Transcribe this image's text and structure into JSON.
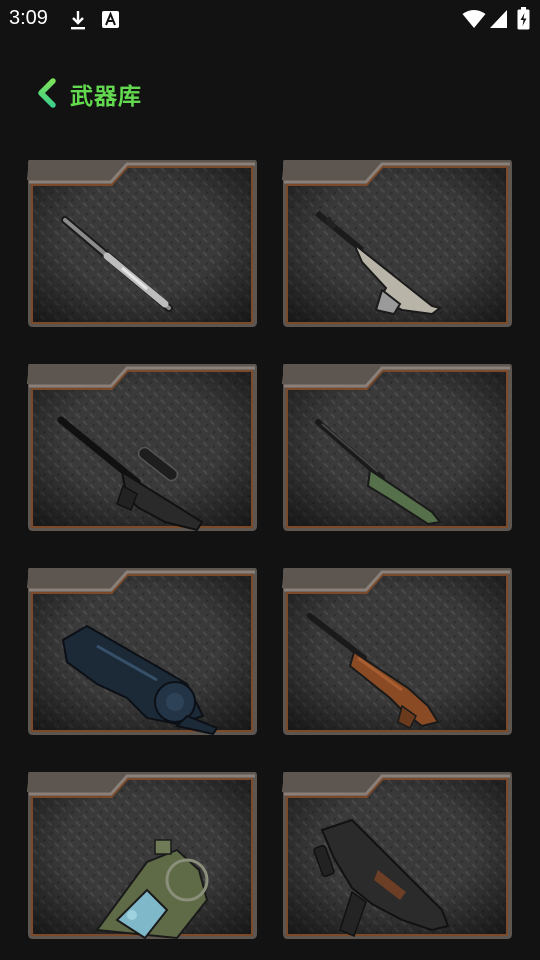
{
  "status_bar": {
    "time": "3:09",
    "left_icons": [
      "download-icon",
      "text-a-icon"
    ],
    "right_icons": [
      "wifi-icon",
      "signal-icon",
      "battery-charging-icon"
    ]
  },
  "header": {
    "back_icon": "chevron-left-icon",
    "title": "武器库",
    "title_color": "#62d94f"
  },
  "colors": {
    "background": "#121212",
    "card_border": "#7a4a2a",
    "card_tab": "#6e6358"
  },
  "weapons": [
    {
      "icon": "thin-rifle-icon"
    },
    {
      "icon": "semi-auto-rifle-icon"
    },
    {
      "icon": "sniper-rifle-icon"
    },
    {
      "icon": "bolt-action-rifle-icon"
    },
    {
      "icon": "revolver-icon"
    },
    {
      "icon": "wooden-rifle-icon"
    },
    {
      "icon": "grenade-launcher-icon"
    },
    {
      "icon": "bullpup-rifle-icon"
    }
  ]
}
